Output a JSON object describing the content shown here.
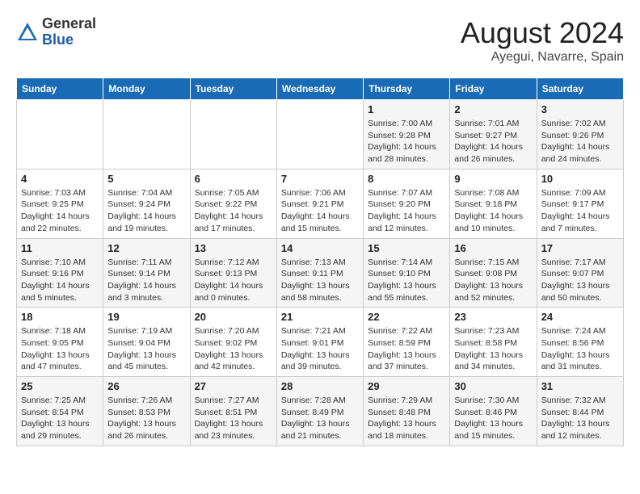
{
  "header": {
    "logo_general": "General",
    "logo_blue": "Blue",
    "month_year": "August 2024",
    "location": "Ayegui, Navarre, Spain"
  },
  "days_of_week": [
    "Sunday",
    "Monday",
    "Tuesday",
    "Wednesday",
    "Thursday",
    "Friday",
    "Saturday"
  ],
  "weeks": [
    [
      {
        "day": "",
        "info": ""
      },
      {
        "day": "",
        "info": ""
      },
      {
        "day": "",
        "info": ""
      },
      {
        "day": "",
        "info": ""
      },
      {
        "day": "1",
        "info": "Sunrise: 7:00 AM\nSunset: 9:28 PM\nDaylight: 14 hours\nand 28 minutes."
      },
      {
        "day": "2",
        "info": "Sunrise: 7:01 AM\nSunset: 9:27 PM\nDaylight: 14 hours\nand 26 minutes."
      },
      {
        "day": "3",
        "info": "Sunrise: 7:02 AM\nSunset: 9:26 PM\nDaylight: 14 hours\nand 24 minutes."
      }
    ],
    [
      {
        "day": "4",
        "info": "Sunrise: 7:03 AM\nSunset: 9:25 PM\nDaylight: 14 hours\nand 22 minutes."
      },
      {
        "day": "5",
        "info": "Sunrise: 7:04 AM\nSunset: 9:24 PM\nDaylight: 14 hours\nand 19 minutes."
      },
      {
        "day": "6",
        "info": "Sunrise: 7:05 AM\nSunset: 9:22 PM\nDaylight: 14 hours\nand 17 minutes."
      },
      {
        "day": "7",
        "info": "Sunrise: 7:06 AM\nSunset: 9:21 PM\nDaylight: 14 hours\nand 15 minutes."
      },
      {
        "day": "8",
        "info": "Sunrise: 7:07 AM\nSunset: 9:20 PM\nDaylight: 14 hours\nand 12 minutes."
      },
      {
        "day": "9",
        "info": "Sunrise: 7:08 AM\nSunset: 9:18 PM\nDaylight: 14 hours\nand 10 minutes."
      },
      {
        "day": "10",
        "info": "Sunrise: 7:09 AM\nSunset: 9:17 PM\nDaylight: 14 hours\nand 7 minutes."
      }
    ],
    [
      {
        "day": "11",
        "info": "Sunrise: 7:10 AM\nSunset: 9:16 PM\nDaylight: 14 hours\nand 5 minutes."
      },
      {
        "day": "12",
        "info": "Sunrise: 7:11 AM\nSunset: 9:14 PM\nDaylight: 14 hours\nand 3 minutes."
      },
      {
        "day": "13",
        "info": "Sunrise: 7:12 AM\nSunset: 9:13 PM\nDaylight: 14 hours\nand 0 minutes."
      },
      {
        "day": "14",
        "info": "Sunrise: 7:13 AM\nSunset: 9:11 PM\nDaylight: 13 hours\nand 58 minutes."
      },
      {
        "day": "15",
        "info": "Sunrise: 7:14 AM\nSunset: 9:10 PM\nDaylight: 13 hours\nand 55 minutes."
      },
      {
        "day": "16",
        "info": "Sunrise: 7:15 AM\nSunset: 9:08 PM\nDaylight: 13 hours\nand 52 minutes."
      },
      {
        "day": "17",
        "info": "Sunrise: 7:17 AM\nSunset: 9:07 PM\nDaylight: 13 hours\nand 50 minutes."
      }
    ],
    [
      {
        "day": "18",
        "info": "Sunrise: 7:18 AM\nSunset: 9:05 PM\nDaylight: 13 hours\nand 47 minutes."
      },
      {
        "day": "19",
        "info": "Sunrise: 7:19 AM\nSunset: 9:04 PM\nDaylight: 13 hours\nand 45 minutes."
      },
      {
        "day": "20",
        "info": "Sunrise: 7:20 AM\nSunset: 9:02 PM\nDaylight: 13 hours\nand 42 minutes."
      },
      {
        "day": "21",
        "info": "Sunrise: 7:21 AM\nSunset: 9:01 PM\nDaylight: 13 hours\nand 39 minutes."
      },
      {
        "day": "22",
        "info": "Sunrise: 7:22 AM\nSunset: 8:59 PM\nDaylight: 13 hours\nand 37 minutes."
      },
      {
        "day": "23",
        "info": "Sunrise: 7:23 AM\nSunset: 8:58 PM\nDaylight: 13 hours\nand 34 minutes."
      },
      {
        "day": "24",
        "info": "Sunrise: 7:24 AM\nSunset: 8:56 PM\nDaylight: 13 hours\nand 31 minutes."
      }
    ],
    [
      {
        "day": "25",
        "info": "Sunrise: 7:25 AM\nSunset: 8:54 PM\nDaylight: 13 hours\nand 29 minutes."
      },
      {
        "day": "26",
        "info": "Sunrise: 7:26 AM\nSunset: 8:53 PM\nDaylight: 13 hours\nand 26 minutes."
      },
      {
        "day": "27",
        "info": "Sunrise: 7:27 AM\nSunset: 8:51 PM\nDaylight: 13 hours\nand 23 minutes."
      },
      {
        "day": "28",
        "info": "Sunrise: 7:28 AM\nSunset: 8:49 PM\nDaylight: 13 hours\nand 21 minutes."
      },
      {
        "day": "29",
        "info": "Sunrise: 7:29 AM\nSunset: 8:48 PM\nDaylight: 13 hours\nand 18 minutes."
      },
      {
        "day": "30",
        "info": "Sunrise: 7:30 AM\nSunset: 8:46 PM\nDaylight: 13 hours\nand 15 minutes."
      },
      {
        "day": "31",
        "info": "Sunrise: 7:32 AM\nSunset: 8:44 PM\nDaylight: 13 hours\nand 12 minutes."
      }
    ]
  ]
}
